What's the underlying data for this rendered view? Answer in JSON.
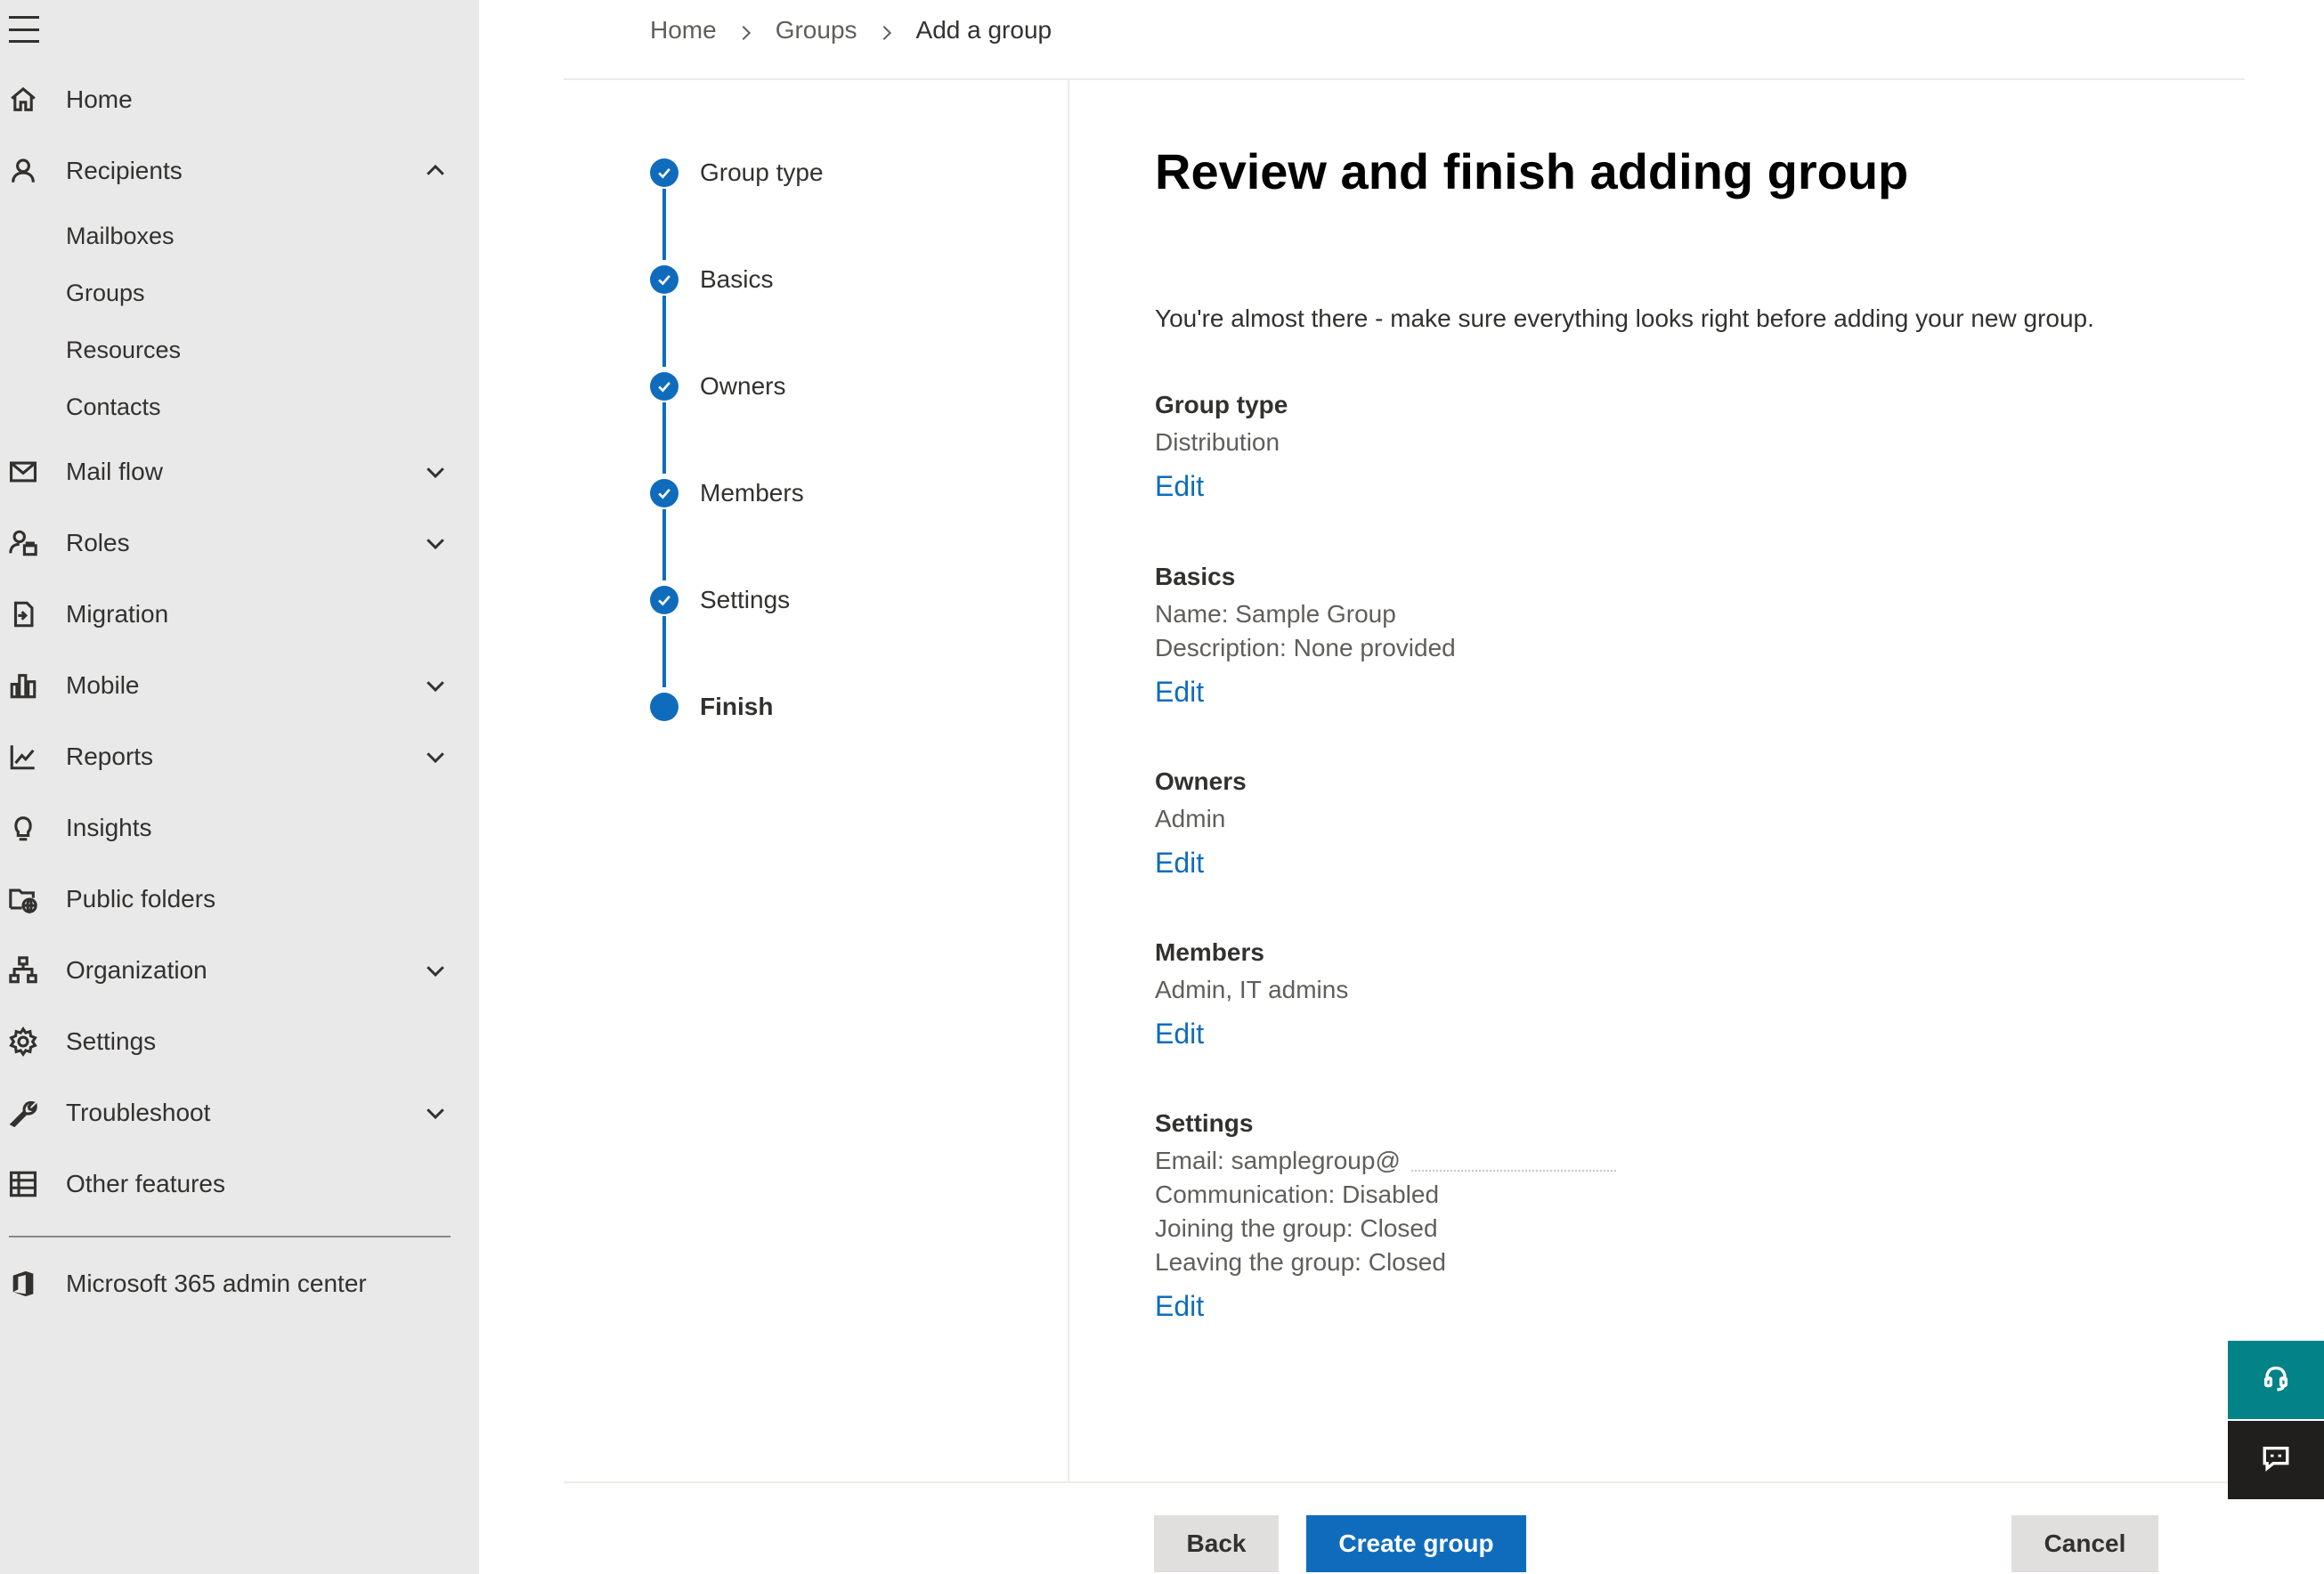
{
  "sidebar": {
    "items": [
      {
        "label": "Home",
        "icon": "home-icon"
      },
      {
        "label": "Recipients",
        "icon": "person-icon",
        "expanded": true,
        "children": [
          "Mailboxes",
          "Groups",
          "Resources",
          "Contacts"
        ]
      },
      {
        "label": "Mail flow",
        "icon": "mail-icon"
      },
      {
        "label": "Roles",
        "icon": "roles-icon"
      },
      {
        "label": "Migration",
        "icon": "migration-icon"
      },
      {
        "label": "Mobile",
        "icon": "mobile-icon"
      },
      {
        "label": "Reports",
        "icon": "chart-icon"
      },
      {
        "label": "Insights",
        "icon": "lightbulb-icon"
      },
      {
        "label": "Public folders",
        "icon": "folder-globe-icon"
      },
      {
        "label": "Organization",
        "icon": "org-chart-icon"
      },
      {
        "label": "Settings",
        "icon": "gear-icon"
      },
      {
        "label": "Troubleshoot",
        "icon": "wrench-icon"
      },
      {
        "label": "Other features",
        "icon": "grid-icon"
      }
    ],
    "footer_link": {
      "label": "Microsoft 365 admin center",
      "icon": "office-icon"
    }
  },
  "breadcrumb": [
    "Home",
    "Groups",
    "Add a group"
  ],
  "stepper": {
    "steps": [
      {
        "label": "Group type",
        "status": "complete"
      },
      {
        "label": "Basics",
        "status": "complete"
      },
      {
        "label": "Owners",
        "status": "complete"
      },
      {
        "label": "Members",
        "status": "complete"
      },
      {
        "label": "Settings",
        "status": "complete"
      },
      {
        "label": "Finish",
        "status": "current"
      }
    ]
  },
  "main": {
    "title": "Review and finish adding group",
    "intro": "You're almost there - make sure everything looks right before adding your new group.",
    "edit_label": "Edit",
    "sections": {
      "group_type": {
        "heading": "Group type",
        "lines": [
          "Distribution"
        ]
      },
      "basics": {
        "heading": "Basics",
        "lines": [
          "Name: Sample Group",
          "Description: None provided"
        ]
      },
      "owners": {
        "heading": "Owners",
        "lines": [
          "Admin"
        ]
      },
      "members": {
        "heading": "Members",
        "lines": [
          "Admin, IT admins"
        ]
      },
      "settings": {
        "heading": "Settings",
        "lines": [
          "Email: samplegroup@",
          "Communication: Disabled",
          "Joining the group: Closed",
          "Leaving the group: Closed"
        ]
      }
    }
  },
  "footer": {
    "back_label": "Back",
    "create_label": "Create group",
    "cancel_label": "Cancel"
  },
  "floating": {
    "help_icon": "headset-icon",
    "feedback_icon": "feedback-icon"
  },
  "colors": {
    "accent": "#0f6cbd",
    "sidebar_bg": "#e9e9e9",
    "help_button": "#038387",
    "feedback_button": "#201f1e"
  }
}
